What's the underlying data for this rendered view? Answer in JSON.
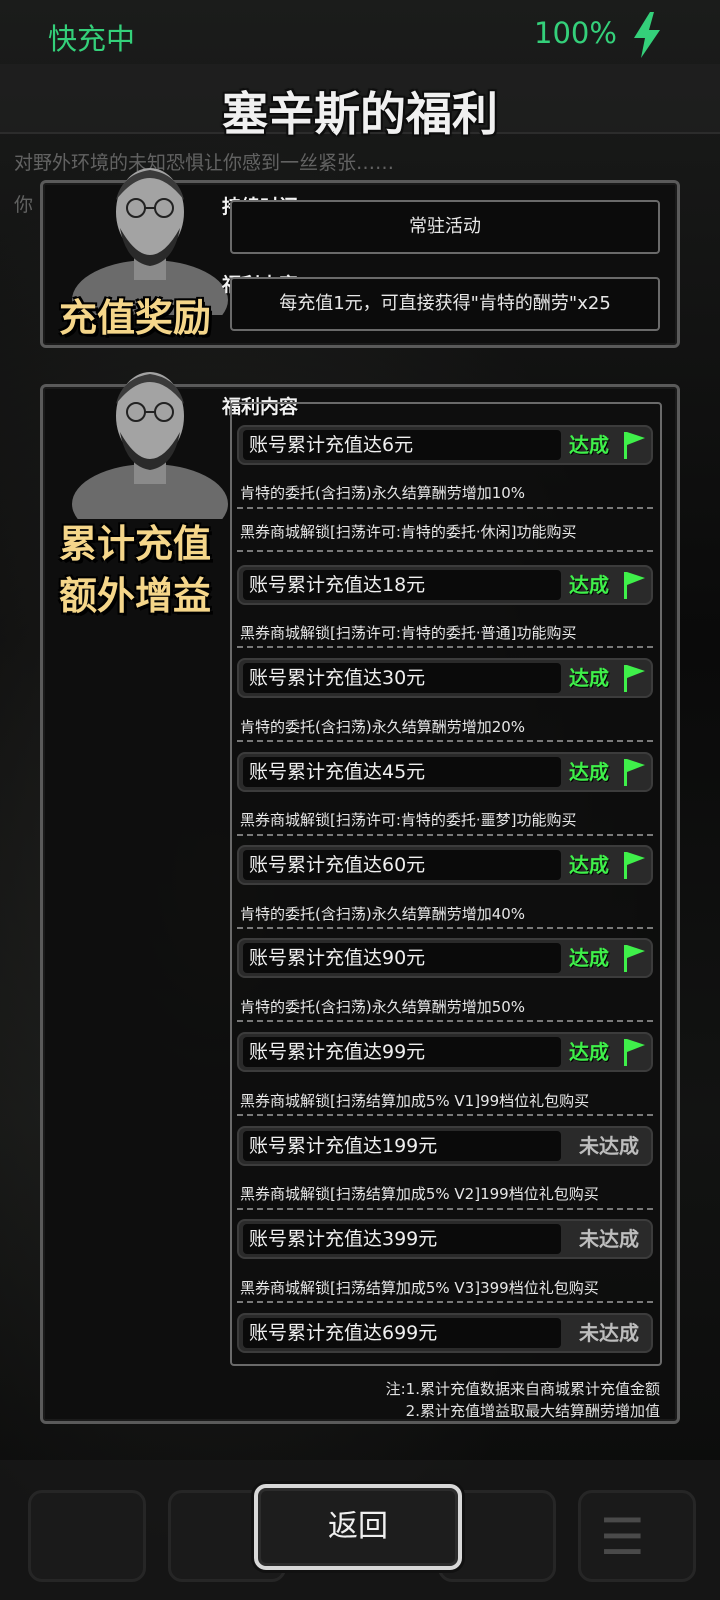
{
  "status": {
    "charging_label": "快充中",
    "battery": "100%"
  },
  "background": {
    "line1": "对野外环境的未知恐惧让你感到一丝紧张……",
    "line2": "你"
  },
  "page_title": "塞辛斯的福利",
  "recharge_reward": {
    "side_label": "充值奖励",
    "duration_label": "持续时间",
    "duration_value": "常驻活动",
    "content_label": "福利内容",
    "content_value": "每充值1元，可直接获得\"肯特的酬劳\"x25"
  },
  "cumulative": {
    "side_label_line1": "累计充值",
    "side_label_line2": "额外增益",
    "content_label": "福利内容",
    "status_done": "达成",
    "status_undone": "未达成",
    "tiers": [
      {
        "label": "账号累计充值达6元",
        "status": "达成",
        "benefits": [
          "肯特的委托(含扫荡)永久结算酬劳增加10%",
          "黑券商城解锁[扫荡许可:肯特的委托·休闲]功能购买"
        ]
      },
      {
        "label": "账号累计充值达18元",
        "status": "达成",
        "benefits": [
          "黑券商城解锁[扫荡许可:肯特的委托·普通]功能购买"
        ]
      },
      {
        "label": "账号累计充值达30元",
        "status": "达成",
        "benefits": [
          "肯特的委托(含扫荡)永久结算酬劳增加20%"
        ]
      },
      {
        "label": "账号累计充值达45元",
        "status": "达成",
        "benefits": [
          "黑券商城解锁[扫荡许可:肯特的委托·噩梦]功能购买"
        ]
      },
      {
        "label": "账号累计充值达60元",
        "status": "达成",
        "benefits": [
          "肯特的委托(含扫荡)永久结算酬劳增加40%"
        ]
      },
      {
        "label": "账号累计充值达90元",
        "status": "达成",
        "benefits": [
          "肯特的委托(含扫荡)永久结算酬劳增加50%"
        ]
      },
      {
        "label": "账号累计充值达99元",
        "status": "达成",
        "benefits": [
          "黑券商城解锁[扫荡结算加成5% V1]99档位礼包购买"
        ]
      },
      {
        "label": "账号累计充值达199元",
        "status": "未达成",
        "benefits": [
          "黑券商城解锁[扫荡结算加成5% V2]199档位礼包购买"
        ]
      },
      {
        "label": "账号累计充值达399元",
        "status": "未达成",
        "benefits": [
          "黑券商城解锁[扫荡结算加成5% V3]399档位礼包购买"
        ]
      },
      {
        "label": "账号累计充值达699元",
        "status": "未达成",
        "benefits": []
      }
    ],
    "notes": [
      "注:1.累计充值数据来自商城累计充值金额",
      "2.累计充值增益取最大结算酬劳增加值"
    ]
  },
  "back_button": "返回",
  "colors": {
    "accent_green": "#3ff04a",
    "status_green": "#34d07a",
    "label_gold": "#f5d68a"
  }
}
